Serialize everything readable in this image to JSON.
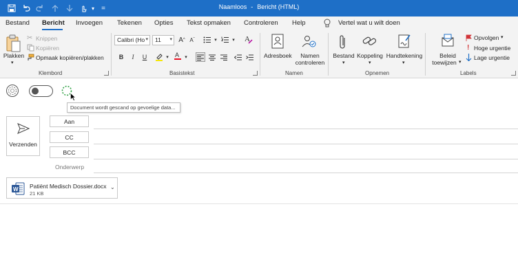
{
  "window": {
    "title_app": "Naamloos",
    "title_sep": "-",
    "title_doc": "Bericht (HTML)"
  },
  "qat": {
    "more_label": "="
  },
  "tabs": [
    {
      "label": "Bestand"
    },
    {
      "label": "Bericht"
    },
    {
      "label": "Invoegen"
    },
    {
      "label": "Tekenen"
    },
    {
      "label": "Opties"
    },
    {
      "label": "Tekst opmaken"
    },
    {
      "label": "Controleren"
    },
    {
      "label": "Help"
    }
  ],
  "tellme": {
    "placeholder": "Vertel wat u wilt doen"
  },
  "ribbon": {
    "clipboard": {
      "paste_label": "Plakken",
      "cut_label": "Knippen",
      "copy_label": "Kopiëren",
      "format_painter_label": "Opmaak kopiëren/plakken",
      "group_label": "Klembord"
    },
    "basictext": {
      "font_name": "Calibri (Ho",
      "font_size": "11",
      "group_label": "Basistekst"
    },
    "names": {
      "addressbook_label": "Adresboek",
      "check_names_line1": "Namen",
      "check_names_line2": "controleren",
      "group_label": "Namen"
    },
    "include": {
      "file_label": "Bestand",
      "link_label": "Koppeling",
      "signature_label": "Handtekening",
      "group_label": "Opnemen"
    },
    "tags": {
      "policy_line1": "Beleid",
      "policy_line2": "toewijzen",
      "followup_label": "Opvolgen",
      "high_label": "Hoge urgentie",
      "low_label": "Lage urgentie",
      "group_label": "Labels"
    }
  },
  "compose": {
    "tooltip": "Document wordt gescand op gevoelige data...",
    "send_label": "Verzenden",
    "to_label": "Aan",
    "cc_label": "CC",
    "bcc_label": "BCC",
    "subject_label": "Onderwerp",
    "attachment": {
      "name": "Patiënt Medisch Dossier.docx",
      "size": "21 KB"
    }
  },
  "colors": {
    "titlebar": "#1e6fc7",
    "accent": "#1e6fc7",
    "spinner": "#2ea043",
    "word_icon": "#2b5797",
    "flag": "#d13438"
  }
}
